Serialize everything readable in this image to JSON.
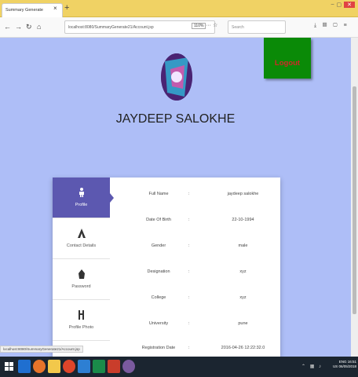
{
  "browser": {
    "tab_title": "Summary Generate",
    "tab_close": "×",
    "new_tab": "+",
    "window_controls": [
      "–",
      "▢",
      "✕"
    ],
    "url": "localhost:8080/SummaryGenerate21/Account.jsp",
    "zoom": "110%",
    "search_placeholder": "Search",
    "status_url": "localhost:8080/SummaryGenerate21/Account.jsp"
  },
  "page": {
    "logout_label": "Logout",
    "user_name": "JAYDEEP SALOKHE",
    "colors": {
      "background": "#aebef7",
      "accent": "#5c58b0",
      "logout_bg": "#0a8a07",
      "logout_text": "#d02828"
    }
  },
  "sidebar": {
    "items": [
      {
        "label": "Profile",
        "icon": "profile-icon",
        "active": true
      },
      {
        "label": "Contact Details",
        "icon": "contact-icon",
        "active": false
      },
      {
        "label": "Password",
        "icon": "password-icon",
        "active": false
      },
      {
        "label": "Profile Photo",
        "icon": "photo-icon",
        "active": false
      }
    ]
  },
  "profile": {
    "rows": [
      {
        "key": "Full Name",
        "sep": ":",
        "value": "jaydeep salokhe"
      },
      {
        "key": "Date Of Birth",
        "sep": ":",
        "value": "22-10-1994"
      },
      {
        "key": "Gender",
        "sep": ":",
        "value": "male"
      },
      {
        "key": "Designation",
        "sep": ":",
        "value": "xyz"
      },
      {
        "key": "College",
        "sep": ":",
        "value": "xyz"
      },
      {
        "key": "University",
        "sep": ":",
        "value": "pune"
      },
      {
        "key": "Registration Date",
        "sep": ":",
        "value": "2016-04-26 12:22:32.0"
      }
    ]
  },
  "taskbar": {
    "time": "16:51",
    "date": "06/05/2018",
    "lang": "ENG",
    "region": "US"
  }
}
